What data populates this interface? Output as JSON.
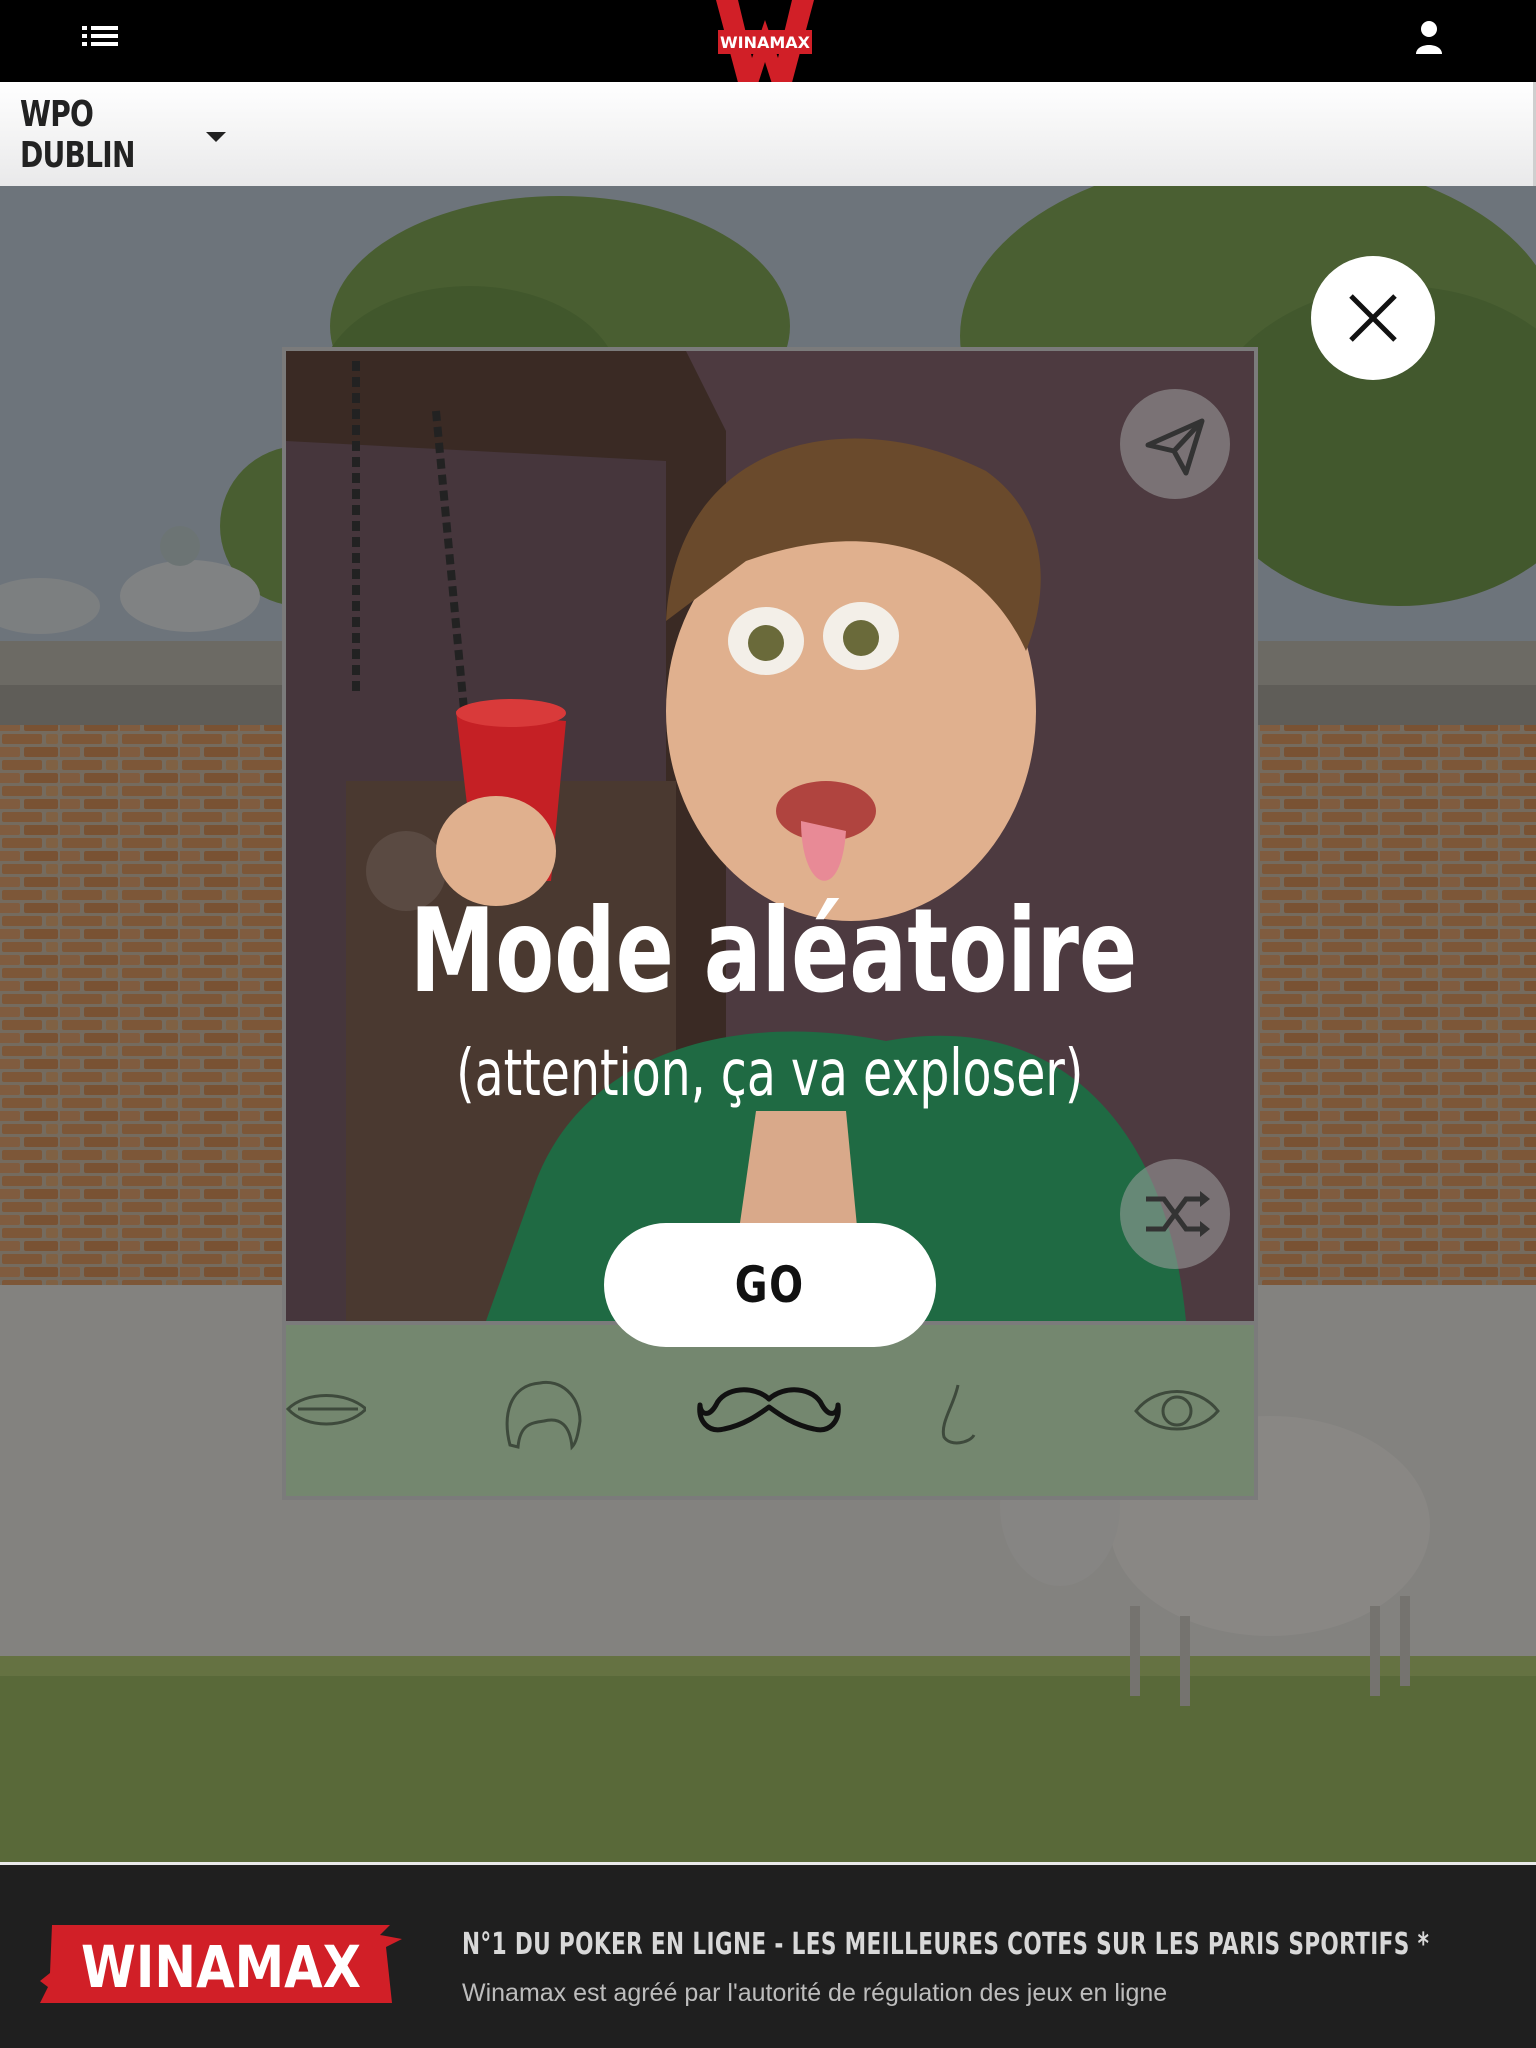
{
  "header": {
    "brand": "WINAMAX",
    "menu_icon": "list-icon",
    "user_icon": "user-icon"
  },
  "subheader": {
    "event_selected": "WPO DUBLIN",
    "caret_icon": "caret-down-icon"
  },
  "modal": {
    "title": "Mode aléatoire",
    "subtitle": "(attention, ça va exploser)",
    "go_label": "GO",
    "share_icon": "paper-plane-icon",
    "random_icon": "shuffle-icon",
    "close_icon": "close-icon",
    "features": [
      {
        "name": "lips",
        "icon": "lips-icon"
      },
      {
        "name": "hair",
        "icon": "hair-icon"
      },
      {
        "name": "mustache",
        "icon": "mustache-icon",
        "active": true
      },
      {
        "name": "nose",
        "icon": "nose-icon"
      },
      {
        "name": "eye",
        "icon": "eye-icon"
      }
    ]
  },
  "footer": {
    "brand": "WINAMAX",
    "tagline": "N°1 DU POKER EN LIGNE - LES MEILLEURES COTES SUR LES PARIS SPORTIFS *",
    "legal": "Winamax est agréé par l'autorité de régulation des jeux en ligne"
  },
  "colors": {
    "brand_red": "#d11f27",
    "overlay": "rgba(40,40,40,0.52)",
    "feature_bar": "#74876f"
  }
}
